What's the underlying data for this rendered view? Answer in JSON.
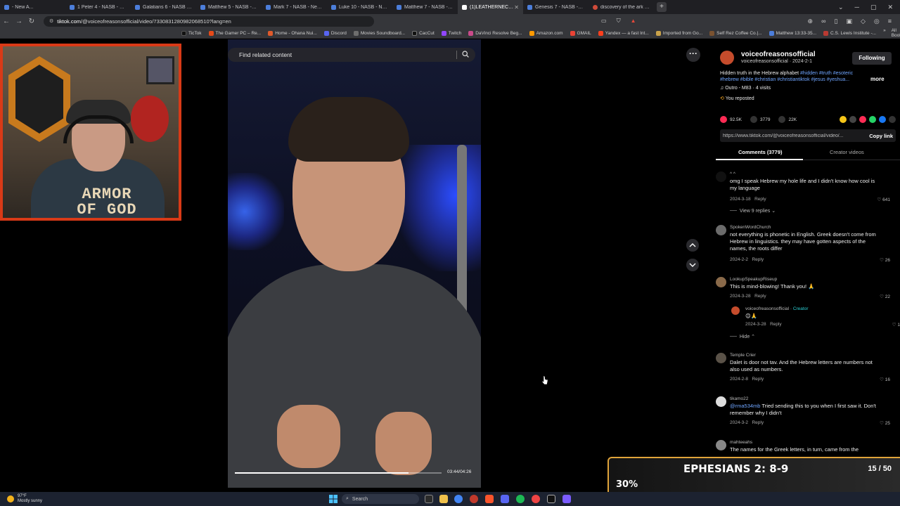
{
  "browser": {
    "tabs": [
      {
        "label": "- New A...",
        "active": false
      },
      {
        "label": "1 Peter 4 - NASB - New A...",
        "active": false
      },
      {
        "label": "Galatians 6 - NASB - New...",
        "active": false
      },
      {
        "label": "Matthew 5 - NASB - New...",
        "active": false
      },
      {
        "label": "Mark 7 - NASB - New Am...",
        "active": false
      },
      {
        "label": "Luke 10 - NASB - New Am...",
        "active": false
      },
      {
        "label": "Matthew 7 - NASB - New...",
        "active": false
      },
      {
        "label": "(1)LEATHERNECK23...",
        "active": true
      },
      {
        "label": "Genesis 7 - NASB - New A...",
        "active": false
      },
      {
        "label": "discovery of the ark - Brav...",
        "active": false
      }
    ],
    "url_host": "tiktok.com",
    "url_path": "/@voiceofreasonsofficial/video/7330831280982068510?lang=en",
    "bookmarks": [
      "TicTok",
      "The Gamer PC – Re...",
      "Home - Ohana Nui...",
      "Discord",
      "Movies Soundboard...",
      "CacCut",
      "Twitch",
      "DaVinci Resolve Beg...",
      "Amazon.com",
      "GMAIL",
      "Yandex — a fast Int...",
      "Imported from Go...",
      "Self Rez Coffee Co.|...",
      "Matthew 13:33-35...",
      "C.S. Lewis Institute -..."
    ],
    "all_bookmarks_label": "All Bookmarks"
  },
  "webcam": {
    "shirt_line1": "ARMOR",
    "shirt_line2": "OF GOD"
  },
  "video": {
    "search_placeholder": "Find related content",
    "time": "03:44/04:26",
    "progress": 0.84
  },
  "post": {
    "username": "voiceofreasonsofficial",
    "meta": "voiceofreasonsofficial · 2024-2-1",
    "follow_label": "Following",
    "description_text": "Hidden truth in the Hebrew alphabet ",
    "hashtags_line1": "#hidden #truth #esoteric",
    "hashtags_line2": "#hebrew #bible #christian #christiantiktok #jesus #yeshua...",
    "more_label": "more",
    "music": "Outro - M83 · 4 visits",
    "repost": "You reposted",
    "likes": "92.5K",
    "comments": "3779",
    "saves": "22K",
    "link": "https://www.tiktok.com/@voiceofreasonsofficial/video/...",
    "copy_link_label": "Copy link"
  },
  "panel_tabs": {
    "comments": "Comments (3779)",
    "creator_videos": "Creator videos"
  },
  "comments": [
    {
      "user": "^ ^",
      "text": "omg I speak Hebrew my hole life and I didn't know how cool is my language",
      "date": "2024-3-18",
      "reply": "Reply",
      "likes": "641",
      "replies_toggle": "View 9 replies"
    },
    {
      "user": "SpokenWordChurch",
      "text": "not everything is phonetic in English. Greek doesn't come from Hebrew in linguistics. they may have gotten aspects of the names, the roots differ",
      "date": "2024-2-2",
      "reply": "Reply",
      "likes": "26"
    },
    {
      "user": "LookupSpeakupRiseup",
      "text": "This is mind-blowing! Thank you! 🙏",
      "date": "2024-3-28",
      "reply": "Reply",
      "likes": "22"
    },
    {
      "user": "Temple Crier",
      "text": "Dalet is door not tav. And the Hebrew letters are numbers not also used as numbers.",
      "date": "2024-2-8",
      "reply": "Reply",
      "likes": "16"
    },
    {
      "user": "tikamo22",
      "mention": "@rma534mb",
      "text": " Tried sending this to you when I first saw it. Don't remember why I didn't",
      "date": "2024-3-2",
      "reply": "Reply",
      "likes": "25"
    },
    {
      "user": "mahteeahs",
      "text": "The names for the Greek letters, in turn, came from the"
    }
  ],
  "creator_reply": {
    "user": "voiceofreasonsofficial",
    "badge": "Creator",
    "text": "😊🙏",
    "date": "2024-3-28",
    "reply": "Reply",
    "likes": "1",
    "hide_label": "Hide"
  },
  "verse_overlay": {
    "title": "EPHESIANS 2: 8-9",
    "count": "15 / 50",
    "percent_label": "30%",
    "progress": 0.3
  },
  "taskbar": {
    "temp": "97°F",
    "weather": "Mostly sunny",
    "search_label": "Search"
  },
  "colors": {
    "accent_link": "#6fa5ff",
    "tiktok_heart": "#ff2b54",
    "overlay_orange": "#ef8a1a",
    "webcam_border": "#d93a17"
  }
}
